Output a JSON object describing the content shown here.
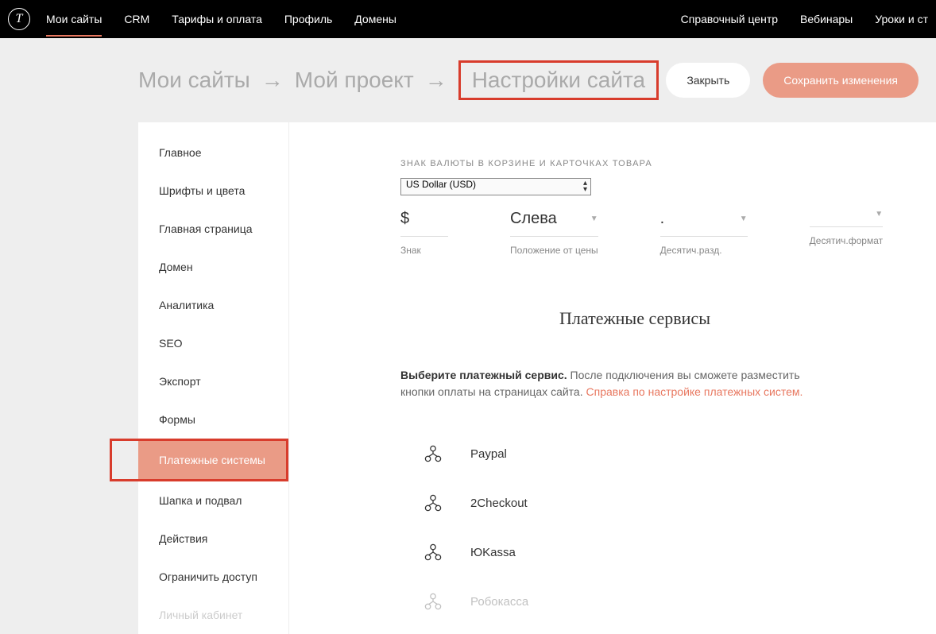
{
  "topnav": {
    "logo": "T",
    "left": [
      "Мои сайты",
      "CRM",
      "Тарифы и оплата",
      "Профиль",
      "Домены"
    ],
    "right": [
      "Справочный центр",
      "Вебинары",
      "Уроки и ст"
    ]
  },
  "breadcrumbs": [
    "Мои сайты",
    "Мой проект",
    "Настройки сайта"
  ],
  "actions": {
    "close": "Закрыть",
    "save": "Сохранить изменения"
  },
  "sidebar": [
    "Главное",
    "Шрифты и цвета",
    "Главная страница",
    "Домен",
    "Аналитика",
    "SEO",
    "Экспорт",
    "Формы",
    "Платежные системы",
    "Шапка и подвал",
    "Действия",
    "Ограничить доступ",
    "Личный кабинет"
  ],
  "currency": {
    "label": "ЗНАК ВАЛЮТЫ В КОРЗИНЕ И КАРТОЧКАХ ТОВАРА",
    "select": "US Dollar (USD)",
    "sign": {
      "value": "$",
      "label": "Знак"
    },
    "position": {
      "value": "Слева",
      "label": "Положение от цены"
    },
    "sep": {
      "value": ".",
      "label": "Десятич.разд."
    },
    "fmt": {
      "value": "",
      "label": "Десятич.формат"
    }
  },
  "payments": {
    "title": "Платежные сервисы",
    "desc_strong": "Выберите платежный сервис.",
    "desc_text": " После подключения вы сможете разместить кнопки оплаты на страницах сайта. ",
    "desc_link": "Справка по настройке платежных систем.",
    "list": [
      "Paypal",
      "2Checkout",
      "ЮKassa",
      "Робокасса"
    ]
  }
}
